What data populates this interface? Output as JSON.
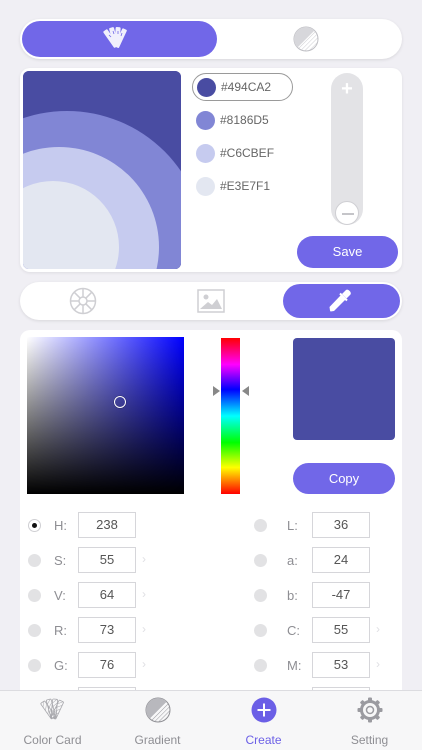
{
  "colors": {
    "accent": "#7167e8",
    "active_tab": "#6b5fe6",
    "selected_color": "#494CA2"
  },
  "top_tabs": [
    {
      "icon": "color-card-fan-icon",
      "active": true
    },
    {
      "icon": "gradient-circle-icon",
      "active": false
    }
  ],
  "palette": {
    "swatches": [
      {
        "hex": "#494CA2",
        "selected": true
      },
      {
        "hex": "#8186D5",
        "selected": false
      },
      {
        "hex": "#C6CBEF",
        "selected": false
      },
      {
        "hex": "#E3E7F1",
        "selected": false
      }
    ],
    "save_label": "Save"
  },
  "tools": [
    {
      "icon": "color-wheel-icon",
      "active": false
    },
    {
      "icon": "image-icon",
      "active": false
    },
    {
      "icon": "eyedropper-icon",
      "active": true
    }
  ],
  "picker": {
    "copy_label": "Copy",
    "left_values": [
      {
        "label": "H:",
        "value": "238",
        "selected": true
      },
      {
        "label": "S:",
        "value": "55",
        "selected": false
      },
      {
        "label": "V:",
        "value": "64",
        "selected": false
      },
      {
        "label": "R:",
        "value": "73",
        "selected": false
      },
      {
        "label": "G:",
        "value": "76",
        "selected": false
      }
    ],
    "right_values": [
      {
        "label": "L:",
        "value": "36",
        "selected": false
      },
      {
        "label": "a:",
        "value": "24",
        "selected": false
      },
      {
        "label": "b:",
        "value": "-47",
        "selected": false
      },
      {
        "label": "C:",
        "value": "55",
        "selected": false
      },
      {
        "label": "M:",
        "value": "53",
        "selected": false
      }
    ]
  },
  "tabbar": [
    {
      "label": "Color Card",
      "icon": "color-card-fan-icon",
      "active": false
    },
    {
      "label": "Gradient",
      "icon": "gradient-circle-icon",
      "active": false
    },
    {
      "label": "Create",
      "icon": "plus-circle-icon",
      "active": true
    },
    {
      "label": "Setting",
      "icon": "gear-icon",
      "active": false
    }
  ]
}
